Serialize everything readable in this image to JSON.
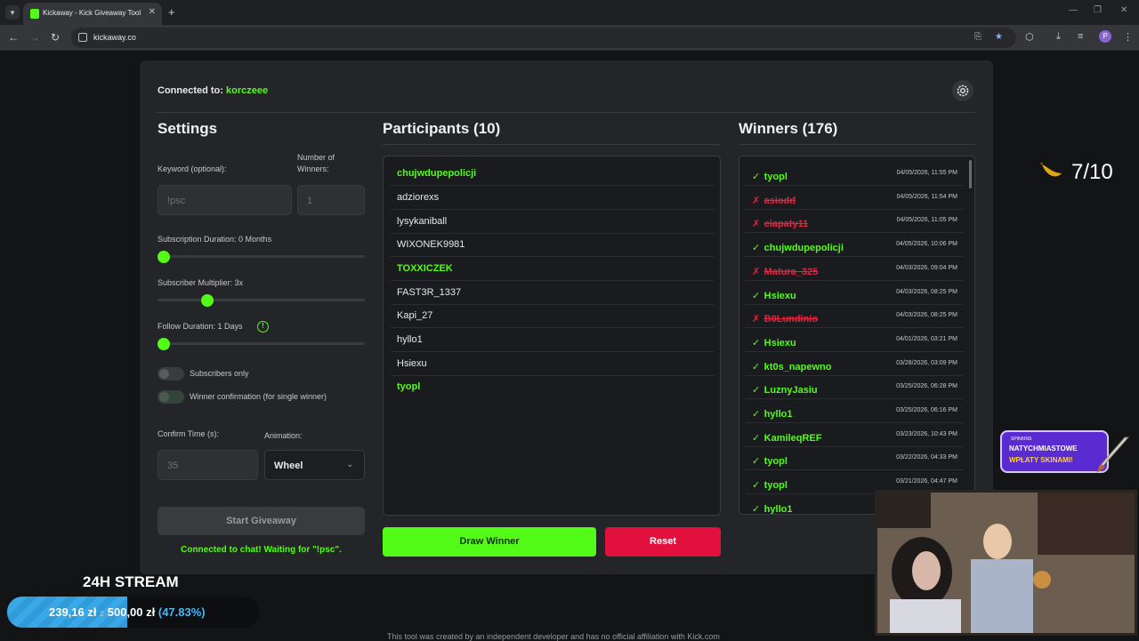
{
  "browser": {
    "tab_title": "Kickaway - Kick Giveaway Tool",
    "url": "kickaway.co",
    "profile_initial": "P"
  },
  "header": {
    "connected_label": "Connected to:",
    "channel": "korczeee"
  },
  "settings": {
    "title": "Settings",
    "keyword_label": "Keyword (optional):",
    "keyword_placeholder": "!psc",
    "winners_label": "Number of Winners:",
    "winners_placeholder": "1",
    "sub_duration_label": "Subscription Duration: 0 Months",
    "sub_multiplier_label": "Subscriber Multiplier: 3x",
    "follow_duration_label": "Follow Duration:  1  Days",
    "info_icon": "!",
    "subscribers_only_label": "Subscribers only",
    "winner_confirmation_label": "Winner confirmation (for single winner)",
    "confirm_time_label": "Confirm Time (s):",
    "confirm_time_placeholder": "35",
    "animation_label": "Animation:",
    "animation_value": "Wheel",
    "start_button": "Start Giveaway",
    "status": "Connected to chat! Waiting for \"!psc\"."
  },
  "participants": {
    "title": "Participants (10)",
    "items": [
      {
        "name": "chujwdupepolicji",
        "highlight": true
      },
      {
        "name": "adziorexs",
        "highlight": false
      },
      {
        "name": "lysykaniball",
        "highlight": false
      },
      {
        "name": "WIXONEK9981",
        "highlight": false
      },
      {
        "name": "TOXXICZEK",
        "highlight": true
      },
      {
        "name": "FAST3R_1337",
        "highlight": false
      },
      {
        "name": "Kapi_27",
        "highlight": false
      },
      {
        "name": "hyllo1",
        "highlight": false
      },
      {
        "name": "Hsiexu",
        "highlight": false
      },
      {
        "name": "tyopl",
        "highlight": true
      }
    ],
    "draw_button": "Draw Winner",
    "reset_button": "Reset"
  },
  "winners": {
    "title": "Winners (176)",
    "items": [
      {
        "mark": "✓",
        "name": "tyopl",
        "date": "04/05/2026, 11:55 PM",
        "confirmed": true
      },
      {
        "mark": "✗",
        "name": "asiodd",
        "date": "04/05/2026, 11:54 PM",
        "confirmed": false
      },
      {
        "mark": "✗",
        "name": "ciapaty11",
        "date": "04/05/2026, 11:05 PM",
        "confirmed": false
      },
      {
        "mark": "✓",
        "name": "chujwdupepolicji",
        "date": "04/05/2026, 10:06 PM",
        "confirmed": true
      },
      {
        "mark": "✗",
        "name": "Matura_325",
        "date": "04/03/2026, 09:04 PM",
        "confirmed": false
      },
      {
        "mark": "✓",
        "name": "Hsiexu",
        "date": "04/03/2026, 08:25 PM",
        "confirmed": true
      },
      {
        "mark": "✗",
        "name": "B0Lundinio",
        "date": "04/03/2026, 08:25 PM",
        "confirmed": false
      },
      {
        "mark": "✓",
        "name": "Hsiexu",
        "date": "04/01/2026, 03:21 PM",
        "confirmed": true
      },
      {
        "mark": "✓",
        "name": "kt0s_napewno",
        "date": "03/28/2026, 03:09 PM",
        "confirmed": true
      },
      {
        "mark": "✓",
        "name": "LuznyJasiu",
        "date": "03/25/2026, 06:28 PM",
        "confirmed": true
      },
      {
        "mark": "✓",
        "name": "hyllo1",
        "date": "03/25/2026, 06:16 PM",
        "confirmed": true
      },
      {
        "mark": "✓",
        "name": "KamileqREF",
        "date": "03/23/2026, 10:43 PM",
        "confirmed": true
      },
      {
        "mark": "✓",
        "name": "tyopl",
        "date": "03/22/2026, 04:33 PM",
        "confirmed": true
      },
      {
        "mark": "✓",
        "name": "tyopl",
        "date": "03/21/2026, 04:47 PM",
        "confirmed": true
      },
      {
        "mark": "✓",
        "name": "hyllo1",
        "date": "",
        "confirmed": true
      }
    ]
  },
  "overlay": {
    "counter": "7/10",
    "promo_small": "SPINKINS",
    "promo_line1": "NATYCHMIASTOWE",
    "promo_line2": "WPŁATY SKINAMI!",
    "stream_title": "24H STREAM",
    "donation_current": "239,16 zł",
    "donation_sep": "z",
    "donation_goal": "500,00 zł",
    "donation_pct": "(47.83%)",
    "donation_fraction": 0.4783,
    "footer": "This tool was created by an independent developer and has no official affiliation with Kick.com"
  }
}
